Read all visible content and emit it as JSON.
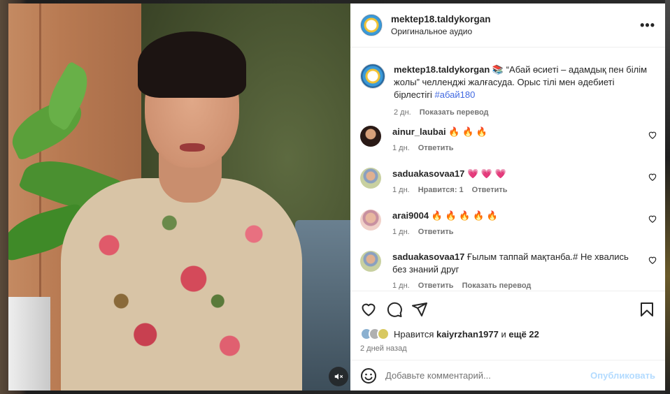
{
  "post": {
    "username": "mektep18.taldykorgan",
    "audio": "Оригинальное аудио",
    "more_label": "•••"
  },
  "caption": {
    "username": "mektep18.taldykorgan",
    "text": " 📚 “Абай өсиеті – адамдық пен білім жолы” челленджі жалғасуда. Орыс тілі мен әдебиеті бірлестігі ",
    "hashtag": "#абай180",
    "age": "2 дн.",
    "translate": "Показать перевод"
  },
  "comments": [
    {
      "username": "ainur_laubai",
      "text": " 🔥 🔥 🔥",
      "age": "1 дн.",
      "likes": "",
      "reply": "Ответить",
      "translate": ""
    },
    {
      "username": "saduakasovaa17",
      "text": " 💗 💗 💗",
      "age": "1 дн.",
      "likes": "Нравится: 1",
      "reply": "Ответить",
      "translate": ""
    },
    {
      "username": "arai9004",
      "text": " 🔥 🔥 🔥 🔥 🔥",
      "age": "1 дн.",
      "likes": "",
      "reply": "Ответить",
      "translate": ""
    },
    {
      "username": "saduakasovaa17",
      "text": " Ғылым таппай мақтанба.# Не хвались без знаний друг",
      "age": "1 дн.",
      "likes": "",
      "reply": "Ответить",
      "translate": "Показать перевод"
    }
  ],
  "likes": {
    "prefix": "Нравится ",
    "user": "kaiyrzhan1977",
    "middle": " и ",
    "rest": "ещё 22"
  },
  "posted_ago": "2 дней назад",
  "add_comment": {
    "placeholder": "Добавьте комментарий...",
    "publish": "Опубликовать"
  },
  "colors": {
    "link": "#4169e1",
    "publish_disabled": "#b3dbff",
    "muted": "#737373"
  }
}
